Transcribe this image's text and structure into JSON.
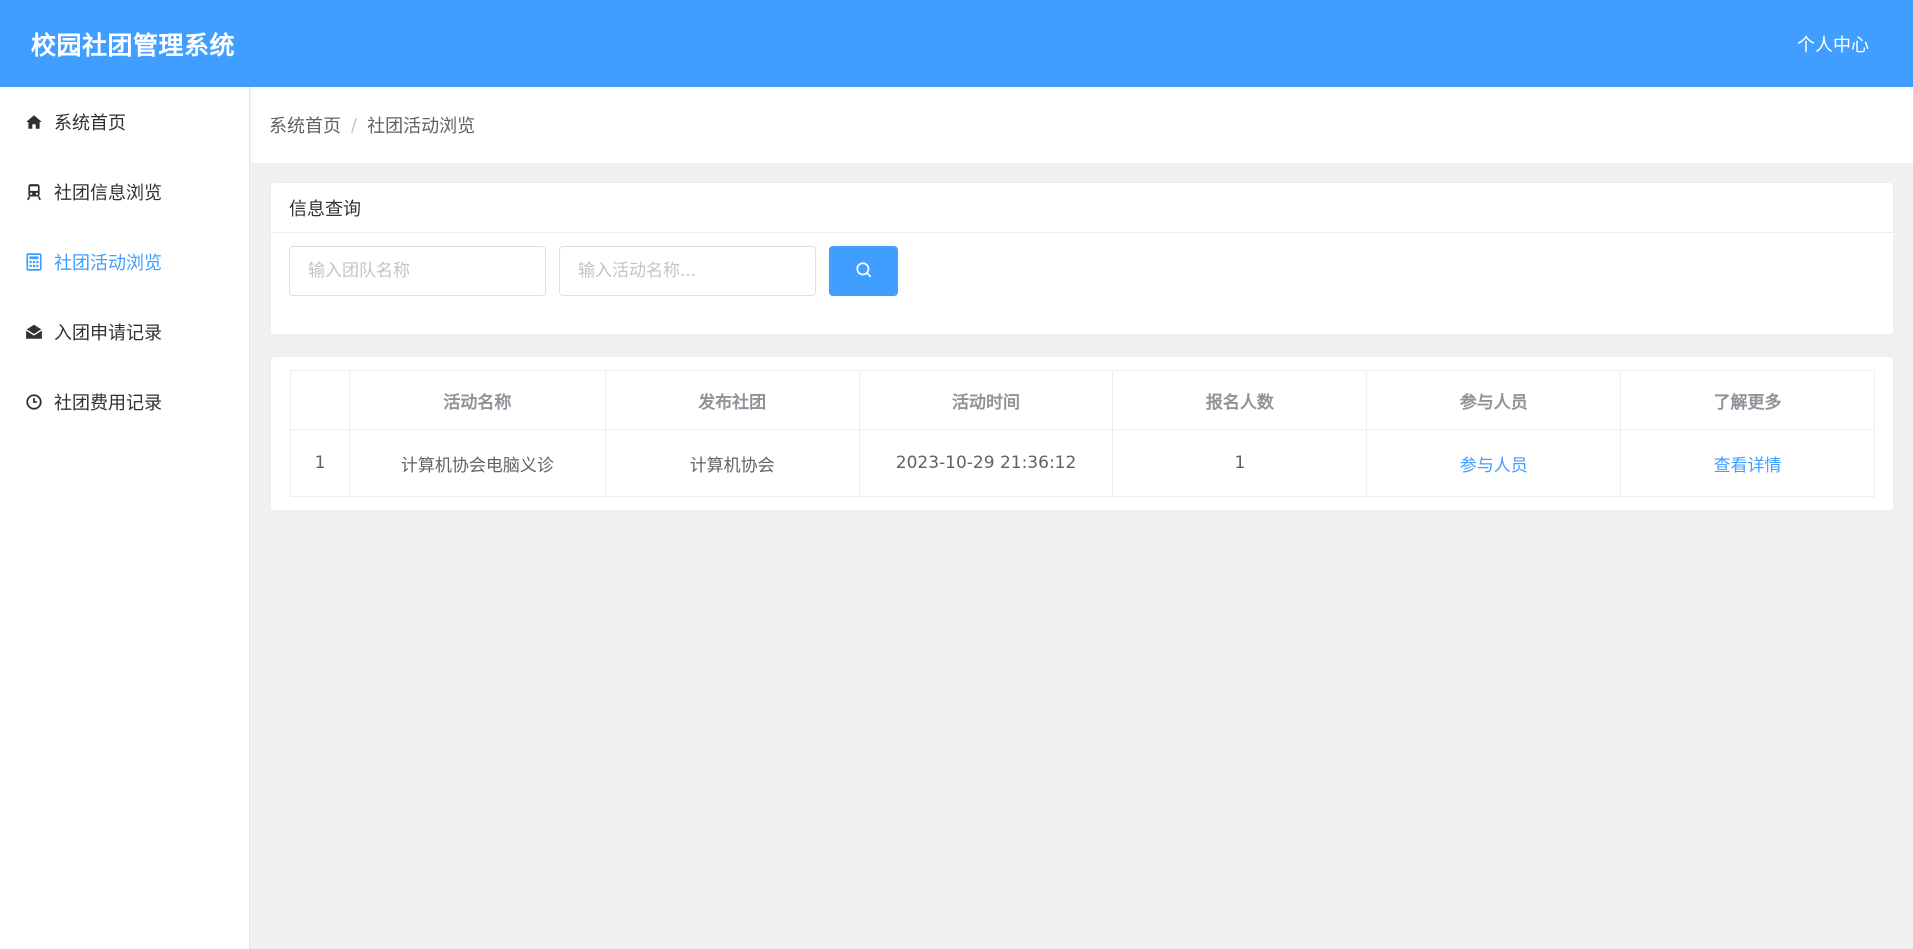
{
  "header": {
    "title": "校园社团管理系统",
    "user_center": "个人中心"
  },
  "sidebar": {
    "items": [
      {
        "label": "系统首页",
        "icon": "home-icon",
        "active": false
      },
      {
        "label": "社团信息浏览",
        "icon": "train-icon",
        "active": false
      },
      {
        "label": "社团活动浏览",
        "icon": "calculator-icon",
        "active": true
      },
      {
        "label": "入团申请记录",
        "icon": "envelope-open-icon",
        "active": false
      },
      {
        "label": "社团费用记录",
        "icon": "clock-icon",
        "active": false
      }
    ]
  },
  "breadcrumb": {
    "home": "系统首页",
    "separator": "/",
    "current": "社团活动浏览"
  },
  "search": {
    "title": "信息查询",
    "team_placeholder": "输入团队名称",
    "activity_placeholder": "输入活动名称...",
    "button_icon": "search-icon"
  },
  "table": {
    "headers": [
      "",
      "活动名称",
      "发布社团",
      "活动时间",
      "报名人数",
      "参与人员",
      "了解更多"
    ],
    "rows": [
      {
        "index": "1",
        "name": "计算机协会电脑义诊",
        "club": "计算机协会",
        "time": "2023-10-29 21:36:12",
        "count": "1",
        "participants": "参与人员",
        "detail": "查看详情"
      }
    ]
  },
  "colors": {
    "primary": "#409eff",
    "background": "#f0f0f0"
  }
}
